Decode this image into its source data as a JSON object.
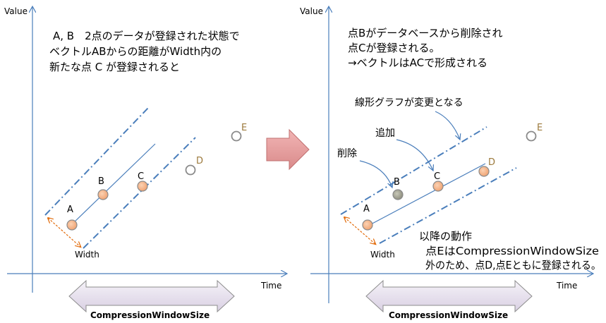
{
  "colors": {
    "axis": "#4a7ebb",
    "line": "#4a7ebb",
    "point_fill": "#f4b183",
    "point_removed_fill": "#a6a6a6",
    "point_empty_fill": "#ffffff",
    "point_label_dark": "#000000",
    "point_label_brown": "#9c7a3c",
    "width_arrow": "#e26b0a",
    "big_arrow_fill": "#e8a3a3",
    "cws_arrow_fill": "#e6e0ec"
  },
  "left": {
    "y_axis_label": "Value",
    "x_axis_label": "Time",
    "description": [
      "A, B　2点のデータが登録された状態で",
      "ベクトルABからの距離がWidth内の",
      "新たな点 C が登録されると"
    ],
    "points": {
      "A": "A",
      "B": "B",
      "C": "C",
      "D": "D",
      "E": "E"
    },
    "width_label": "Width",
    "cws_label": "CompressionWindowSize"
  },
  "right": {
    "y_axis_label": "Value",
    "x_axis_label": "Time",
    "description": [
      "点Bがデータベースから削除され",
      "点Cが登録される。",
      "→ベクトルはACで形成される"
    ],
    "callout_graph_change": "線形グラフが変更となる",
    "callout_add": "追加",
    "callout_delete": "削除",
    "points": {
      "A": "A",
      "B": "B",
      "C": "C",
      "D": "D",
      "E": "E"
    },
    "width_label": "Width",
    "subsequent": [
      "以降の動作",
      "点EはCompressionWindowSize",
      "外のため、点D,点Eともに登録される。"
    ],
    "cws_label": "CompressionWindowSize"
  }
}
